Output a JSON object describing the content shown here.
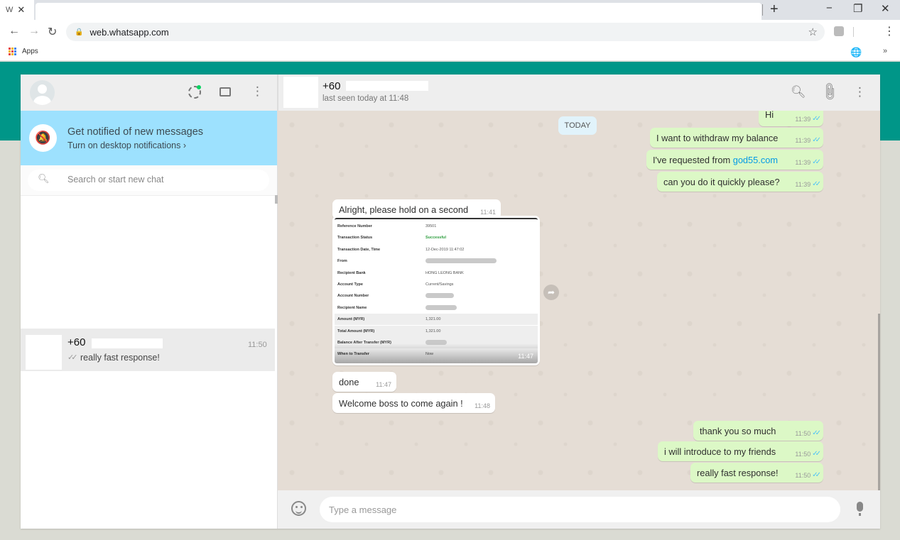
{
  "browser": {
    "tab_title": "W",
    "tab_close": "✕",
    "new_tab": "+",
    "minimize": "−",
    "restore": "❐",
    "close": "✕",
    "url": "web.whatsapp.com",
    "bookmarks_apps": "Apps"
  },
  "sidebar": {
    "notification": {
      "title": "Get notified of new messages",
      "subtitle": "Turn on desktop notifications ›"
    },
    "search_placeholder": "Search or start new chat",
    "chats": [
      {
        "name": "+60",
        "time": "11:50",
        "preview": "really fast response!"
      }
    ]
  },
  "conversation": {
    "contact_name": "+60",
    "contact_status": "last seen today at 11:48",
    "date_chip": "TODAY",
    "messages": [
      {
        "direction": "out",
        "text": "Hi",
        "time": "11:39"
      },
      {
        "direction": "out",
        "text": "I want to withdraw my balance",
        "time": "11:39"
      },
      {
        "direction": "out",
        "text": "I've requested from ",
        "link": "god55.com",
        "time": "11:39"
      },
      {
        "direction": "out",
        "text": "can you do it quickly please?",
        "time": "11:39"
      },
      {
        "direction": "in",
        "text": "Alright, please hold on a second",
        "time": "11:41"
      },
      {
        "direction": "in",
        "text": "done",
        "time": "11:47"
      },
      {
        "direction": "in",
        "text": "Welcome boss to come again !",
        "time": "11:48"
      },
      {
        "direction": "out",
        "text": "thank you so much",
        "time": "11:50"
      },
      {
        "direction": "out",
        "text": "i will introduce to my friends",
        "time": "11:50"
      },
      {
        "direction": "out",
        "text": "really fast response!",
        "time": "11:50"
      }
    ],
    "receipt": {
      "time": "11:47",
      "rows": [
        {
          "label": "Reference Number",
          "value": "39501"
        },
        {
          "label": "Transaction Status",
          "value": "Successful"
        },
        {
          "label": "Transaction Date, Time",
          "value": "12-Dec-2019 11:47:02"
        },
        {
          "label": "From",
          "value": ""
        },
        {
          "label": "Recipient Bank",
          "value": "HONG LEONG BANK"
        },
        {
          "label": "Account Type",
          "value": "Current/Savings"
        },
        {
          "label": "Account Number",
          "value": ""
        },
        {
          "label": "Recipient Name",
          "value": ""
        },
        {
          "label": "Amount (MYR)",
          "value": "1,321.00"
        },
        {
          "label": "Total Amount (MYR)",
          "value": "1,321.00"
        },
        {
          "label": "Balance After Transfer (MYR)",
          "value": ""
        },
        {
          "label": "When to Transfer",
          "value": "Now"
        }
      ]
    },
    "input_placeholder": "Type a message"
  }
}
